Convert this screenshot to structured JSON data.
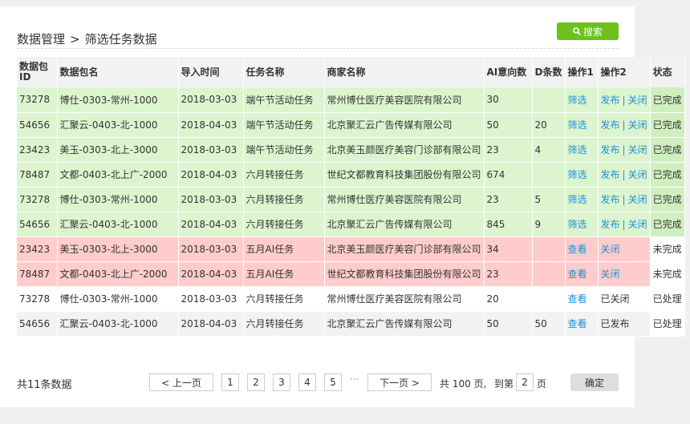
{
  "breadcrumb": {
    "root": "数据管理",
    "separator": ">",
    "current": "筛选任务数据"
  },
  "search_button": {
    "label": "搜索",
    "icon": "search-icon"
  },
  "colors": {
    "accent": "#6cc21a",
    "row_done": "#dcf5cf",
    "row_pending": "#ffcccc",
    "link": "#1f8fd6"
  },
  "table": {
    "headers": {
      "pkg_id": "数据包ID",
      "pkg_name": "数据包名",
      "import_time": "导入时间",
      "task_name": "任务名称",
      "merchant": "商家名称",
      "ai": "AI意向数",
      "d": "D条数",
      "op1": "操作1",
      "op2": "操作2",
      "status": "状态"
    },
    "rows": [
      {
        "id": "73278",
        "name": "博仕-0303-常州-1000",
        "time": "2018-03-03",
        "task": "端午节活动任务",
        "merchant": "常州博仕医疗美容医院有限公司",
        "ai": "30",
        "d": "",
        "op1": "筛选",
        "op2_a": "发布",
        "op2_sep": "|",
        "op2_b": "关闭",
        "status": "已完成"
      },
      {
        "id": "54656",
        "name": "汇聚云-0403-北-1000",
        "time": "2018-04-03",
        "task": "端午节活动任务",
        "merchant": "北京聚汇云广告传媒有限公司",
        "ai": "50",
        "d": "20",
        "op1": "筛选",
        "op2_a": "发布",
        "op2_sep": "|",
        "op2_b": "关闭",
        "status": "已完成"
      },
      {
        "id": "23423",
        "name": "美玉-0303-北上-3000",
        "time": "2018-03-03",
        "task": "端午节活动任务",
        "merchant": "北京美玉颜医疗美容门诊部有限公司",
        "ai": "23",
        "d": "4",
        "op1": "筛选",
        "op2_a": "发布",
        "op2_sep": "|",
        "op2_b": "关闭",
        "status": "已完成"
      },
      {
        "id": "78487",
        "name": "文都-0403-北上广-2000",
        "time": "2018-04-03",
        "task": "六月转接任务",
        "merchant": "世纪文都教育科技集团股份有限公司",
        "ai": "674",
        "d": "",
        "op1": "筛选",
        "op2_a": "发布",
        "op2_sep": "|",
        "op2_b": "关闭",
        "status": "已完成"
      },
      {
        "id": "73278",
        "name": "博仕-0303-常州-1000",
        "time": "2018-03-03",
        "task": "六月转接任务",
        "merchant": "常州博仕医疗美容医院有限公司",
        "ai": "23",
        "d": "5",
        "op1": "筛选",
        "op2_a": "发布",
        "op2_sep": "|",
        "op2_b": "关闭",
        "status": "已完成"
      },
      {
        "id": "54656",
        "name": "汇聚云-0403-北-1000",
        "time": "2018-04-03",
        "task": "六月转接任务",
        "merchant": "北京聚汇云广告传媒有限公司",
        "ai": "845",
        "d": "9",
        "op1": "筛选",
        "op2_a": "发布",
        "op2_sep": "|",
        "op2_b": "关闭",
        "status": "已完成"
      },
      {
        "id": "23423",
        "name": "美玉-0303-北上-3000",
        "time": "2018-03-03",
        "task": "五月AI任务",
        "merchant": "北京美玉颜医疗美容门诊部有限公司",
        "ai": "34",
        "d": "",
        "op1": "查看",
        "op2_a": "关闭",
        "op2_sep": "",
        "op2_b": "",
        "status": "未完成"
      },
      {
        "id": "78487",
        "name": "文都-0403-北上广-2000",
        "time": "2018-04-03",
        "task": "五月AI任务",
        "merchant": "世纪文都教育科技集团股份有限公司",
        "ai": "23",
        "d": "",
        "op1": "查看",
        "op2_a": "关闭",
        "op2_sep": "",
        "op2_b": "",
        "status": "未完成"
      },
      {
        "id": "73278",
        "name": "博仕-0303-常州-1000",
        "time": "2018-03-03",
        "task": "六月转接任务",
        "merchant": "常州博仕医疗美容医院有限公司",
        "ai": "20",
        "d": "",
        "op1": "查看",
        "op2_text": "已关闭",
        "status": "已处理"
      },
      {
        "id": "54656",
        "name": "汇聚云-0403-北-1000",
        "time": "2018-04-03",
        "task": "六月转接任务",
        "merchant": "北京聚汇云广告传媒有限公司",
        "ai": "50",
        "d": "50",
        "op1": "查看",
        "op2_text": "已发布",
        "status": "已处理"
      }
    ]
  },
  "footer": {
    "total": "共11条数据",
    "prev": "< 上一页",
    "pages": [
      "1",
      "2",
      "3",
      "4",
      "5"
    ],
    "ellipsis": "···",
    "next": "下一页 >",
    "total_pages": "共 100 页,",
    "goto_prefix": "到第",
    "goto_value": "2",
    "goto_suffix": "页",
    "confirm": "确定"
  }
}
